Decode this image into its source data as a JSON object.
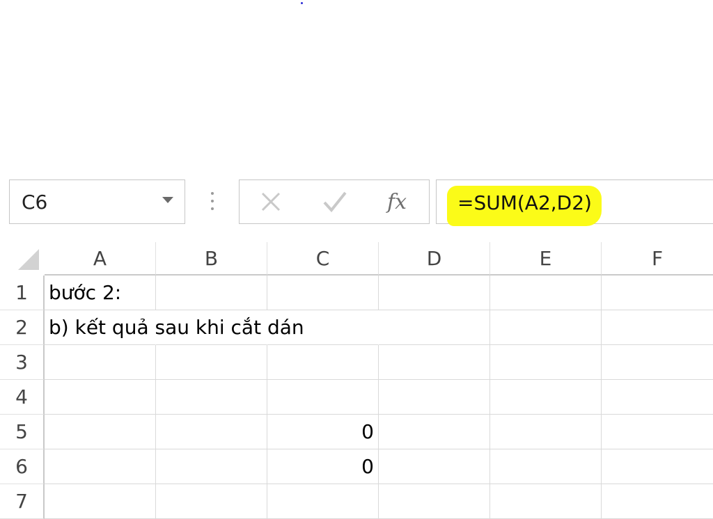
{
  "formula_bar": {
    "name_box": "C6",
    "cancel_icon": "cancel-x-icon",
    "enter_icon": "checkmark-icon",
    "function_label": "fx",
    "formula": "=SUM(A2,D2)",
    "highlight_color": "#fbfb18"
  },
  "columns": [
    "A",
    "B",
    "C",
    "D",
    "E",
    "F"
  ],
  "rows": [
    "1",
    "2",
    "3",
    "4",
    "5",
    "6",
    "7"
  ],
  "cells": {
    "A1": "bước 2:",
    "A2": "b) kết quả sau khi cắt dán",
    "C5": "0",
    "C6": "0"
  }
}
